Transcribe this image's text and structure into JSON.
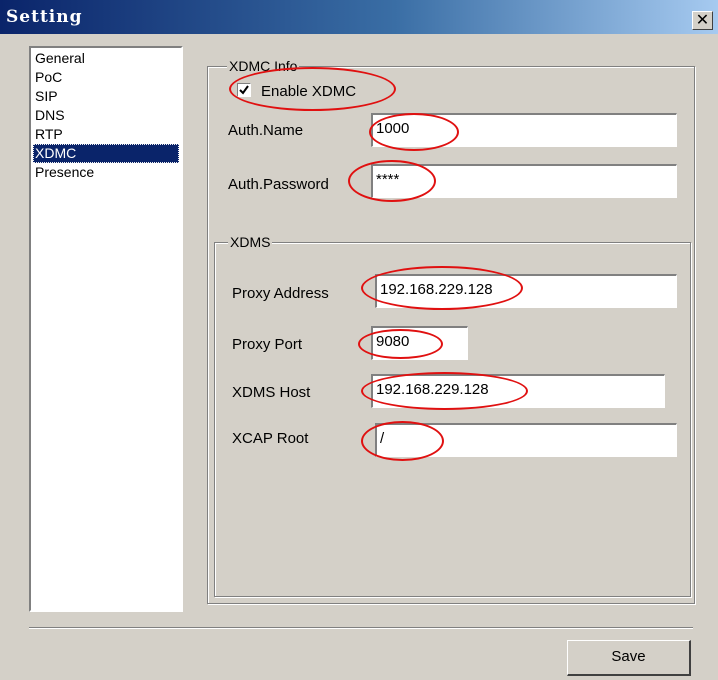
{
  "window": {
    "title": "Setting",
    "close_symbol": "✕"
  },
  "sidebar": {
    "items": [
      {
        "label": "General",
        "selected": false
      },
      {
        "label": "PoC",
        "selected": false
      },
      {
        "label": "SIP",
        "selected": false
      },
      {
        "label": "DNS",
        "selected": false
      },
      {
        "label": "RTP",
        "selected": false
      },
      {
        "label": "XDMC",
        "selected": true
      },
      {
        "label": "Presence",
        "selected": false
      }
    ]
  },
  "xdmc_info": {
    "group_label": "XDMC Info",
    "enable_label": "Enable XDMC",
    "enable_checked": true,
    "auth_name_label": "Auth.Name",
    "auth_name_value": "1000",
    "auth_password_label": "Auth.Password",
    "auth_password_value": "****"
  },
  "xdms": {
    "group_label": "XDMS",
    "proxy_address_label": "Proxy Address",
    "proxy_address_value": "192.168.229.128",
    "proxy_port_label": "Proxy Port",
    "proxy_port_value": "9080",
    "xdms_host_label": "XDMS Host",
    "xdms_host_value": "192.168.229.128",
    "xcap_root_label": "XCAP Root",
    "xcap_root_value": "/"
  },
  "footer": {
    "save_label": "Save"
  },
  "colors": {
    "annotation": "#e01010",
    "selection": "#0a246a",
    "titlebar": "#0a246a"
  }
}
